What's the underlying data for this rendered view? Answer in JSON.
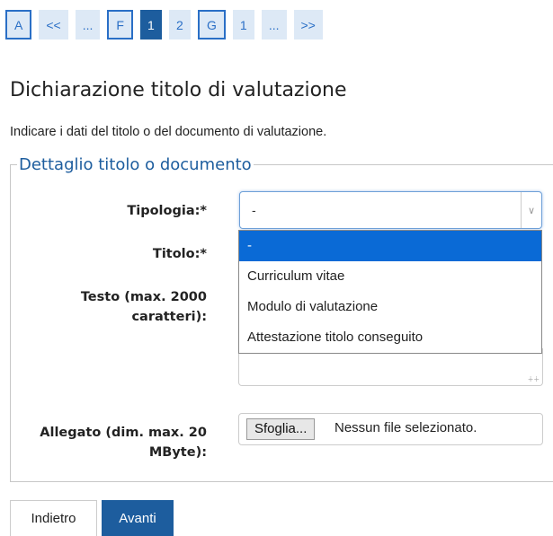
{
  "pager": {
    "items": [
      {
        "label": "A",
        "style": "outlined"
      },
      {
        "label": "<<",
        "style": "plain"
      },
      {
        "label": "...",
        "style": "plain"
      },
      {
        "label": "F",
        "style": "outlined"
      },
      {
        "label": "1",
        "style": "active"
      },
      {
        "label": "2",
        "style": "plain"
      },
      {
        "label": "G",
        "style": "outlined"
      },
      {
        "label": "1",
        "style": "plain"
      },
      {
        "label": "...",
        "style": "plain"
      },
      {
        "label": ">>",
        "style": "plain"
      }
    ]
  },
  "page": {
    "title": "Dichiarazione titolo di valutazione",
    "intro": "Indicare i dati del titolo o del documento di valutazione."
  },
  "fieldset": {
    "legend": "Dettaglio titolo o documento",
    "tipologia_label": "Tipologia:*",
    "tipologia_value": "-",
    "tipologia_options": [
      "-",
      "Curriculum vitae",
      "Modulo di valutazione",
      "Attestazione titolo conseguito"
    ],
    "titolo_label": "Titolo:*",
    "testo_label_1": "Testo (max. 2000",
    "testo_label_2": "caratteri):",
    "allegato_label_1": "Allegato (dim. max. 20",
    "allegato_label_2": "MByte):",
    "file_button": "Sfoglia...",
    "file_status": "Nessun file selezionato."
  },
  "buttons": {
    "back": "Indietro",
    "next": "Avanti"
  },
  "colors": {
    "accent": "#1d5d9e",
    "pager_bg": "#dde9f6",
    "selected_option": "#0a6ad6"
  }
}
